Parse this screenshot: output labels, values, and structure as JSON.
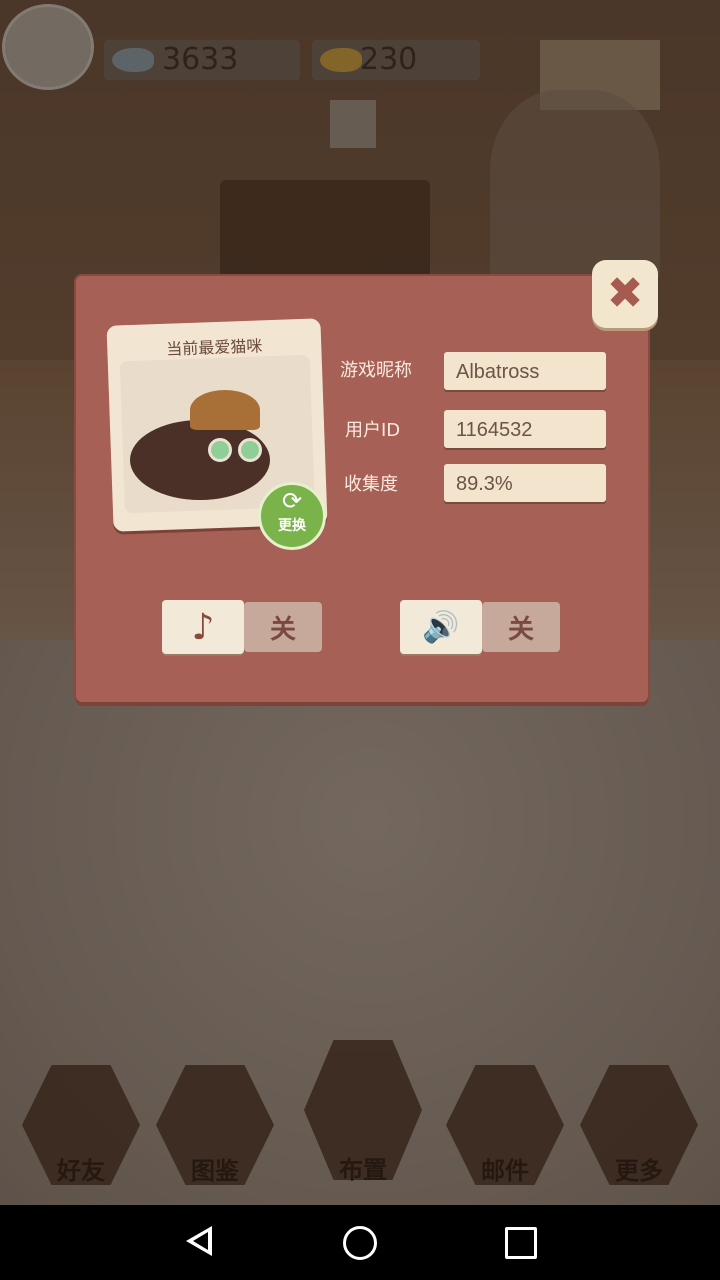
{
  "resources": {
    "fish_count": "3633",
    "goldfish_count": "230"
  },
  "dialog": {
    "photo_title": "当前最爱猫咪",
    "swap_label": "更换",
    "fields": [
      {
        "label": "游戏昵称",
        "value": "Albatross"
      },
      {
        "label": "用户ID",
        "value": "1164532"
      },
      {
        "label": "收集度",
        "value": "89.3%"
      }
    ],
    "music_toggle": {
      "on_icon": "♪",
      "off_label": "关"
    },
    "sound_toggle": {
      "on_icon": "🔊",
      "off_label": "关"
    },
    "close_icon": "✖"
  },
  "bottom_nav": [
    {
      "label": "好友"
    },
    {
      "label": "图鉴"
    },
    {
      "label": "布置"
    },
    {
      "label": "邮件"
    },
    {
      "label": "更多"
    }
  ],
  "colors": {
    "dialog_bg": "#a66055",
    "field_bg": "#f2e4cd",
    "accent_green": "#7ab34a"
  }
}
